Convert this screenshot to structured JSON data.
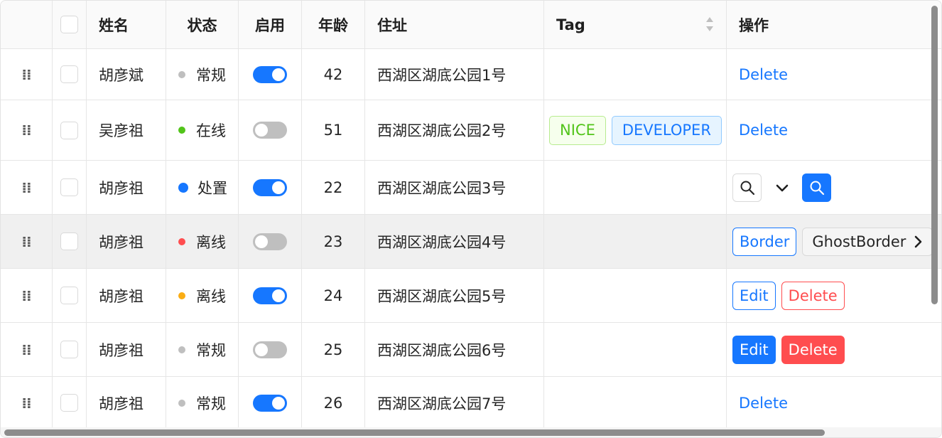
{
  "columns": {
    "name": "姓名",
    "status": "状态",
    "enabled": "启用",
    "age": "年龄",
    "address": "住址",
    "tag": "Tag",
    "action": "操作"
  },
  "colors": {
    "primary": "#1677ff",
    "danger": "#ff4d4f",
    "success": "#52c41a",
    "warning": "#faad14",
    "default": "#bfbfbf"
  },
  "rows": [
    {
      "name": "胡彦斌",
      "status": "常规",
      "enabled": true,
      "age": "42",
      "address": "西湖区湖底公园1号",
      "actions": {
        "delete": "Delete"
      }
    },
    {
      "name": "吴彦祖",
      "status": "在线",
      "enabled": false,
      "age": "51",
      "address": "西湖区湖底公园2号",
      "tags": [
        "NICE",
        "DEVELOPER"
      ],
      "actions": {
        "delete": "Delete"
      }
    },
    {
      "name": "胡彦祖",
      "status": "处置",
      "enabled": true,
      "age": "22",
      "address": "西湖区湖底公园3号",
      "actions": {
        "icons": [
          "search-icon",
          "chevron-down-icon",
          "search-icon"
        ]
      }
    },
    {
      "name": "胡彦祖",
      "status": "离线",
      "enabled": false,
      "age": "23",
      "address": "西湖区湖底公园4号",
      "actions": {
        "border": "Border",
        "ghost_border": "GhostBorder"
      }
    },
    {
      "name": "胡彦祖",
      "status": "离线",
      "enabled": true,
      "age": "24",
      "address": "西湖区湖底公园5号",
      "actions": {
        "edit": "Edit",
        "delete": "Delete"
      }
    },
    {
      "name": "胡彦祖",
      "status": "常规",
      "enabled": false,
      "age": "25",
      "address": "西湖区湖底公园6号",
      "actions": {
        "edit": "Edit",
        "delete": "Delete"
      }
    },
    {
      "name": "胡彦祖",
      "status": "常规",
      "enabled": true,
      "age": "26",
      "address": "西湖区湖底公园7号",
      "actions": {
        "delete": "Delete"
      }
    }
  ]
}
